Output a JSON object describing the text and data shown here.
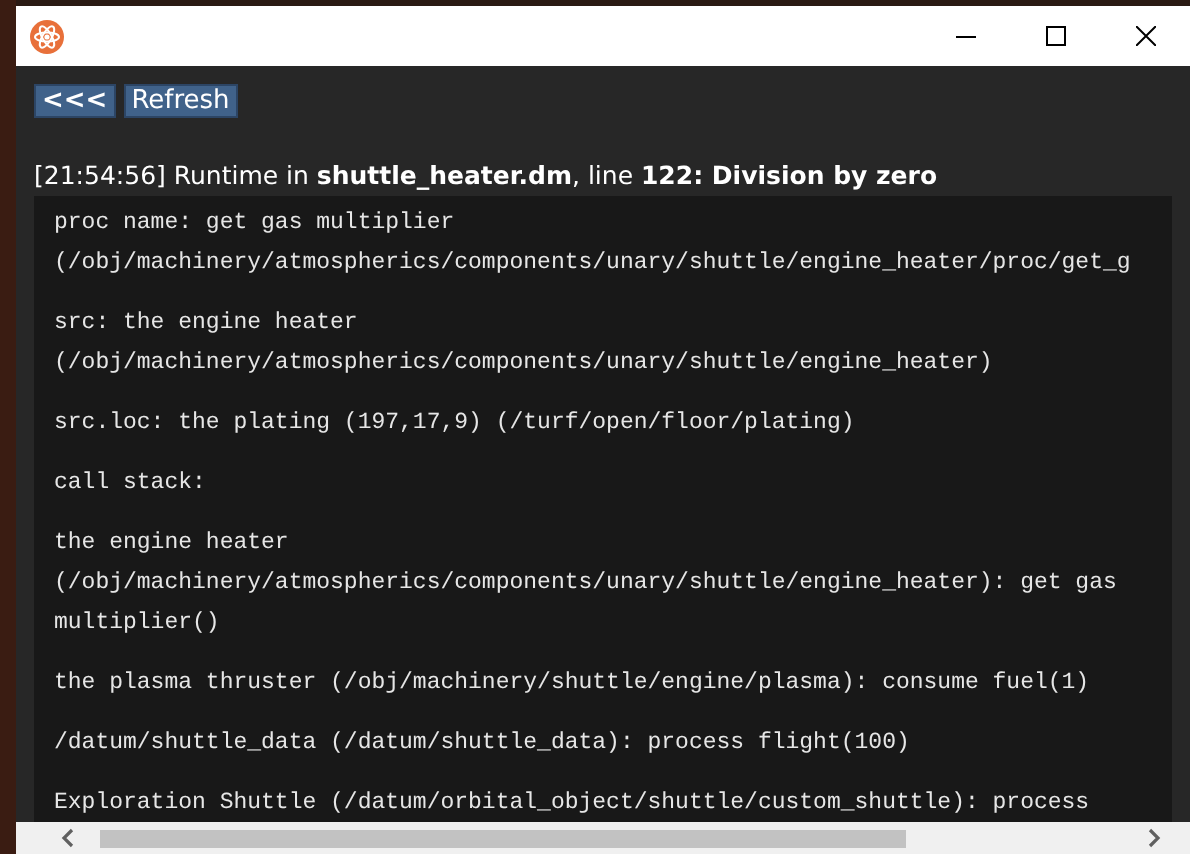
{
  "toolbar": {
    "buttons": [
      "<<<",
      "Refresh"
    ]
  },
  "error_heading": "[21:54:56] Runtime in **shuttle_heater.dm**, line **122: Division by zero**",
  "log_entries": [
    {
      "lines": [
        "proc name: get gas multiplier",
        "(/obj/machinery/atmospherics/components/unary/shuttle/engine_heater/proc/get_g"
      ]
    },
    {
      "lines": [
        "src: the engine heater",
        "(/obj/machinery/atmospherics/components/unary/shuttle/engine_heater)"
      ]
    },
    {
      "lines": [
        "src.loc: the plating (197,17,9) (/turf/open/floor/plating)"
      ]
    },
    {
      "lines": [
        "call stack:"
      ]
    },
    {
      "lines": [
        "the engine heater",
        "(/obj/machinery/atmospherics/components/unary/shuttle/engine_heater): get gas",
        "multiplier()"
      ]
    },
    {
      "lines": [
        "the plasma thruster (/obj/machinery/shuttle/engine/plasma): consume fuel(1)"
      ]
    },
    {
      "lines": [
        "/datum/shuttle_data (/datum/shuttle_data): process flight(100)"
      ]
    },
    {
      "lines": [
        "Exploration Shuttle (/datum/orbital_object/shuttle/custom_shuttle): process"
      ]
    }
  ]
}
